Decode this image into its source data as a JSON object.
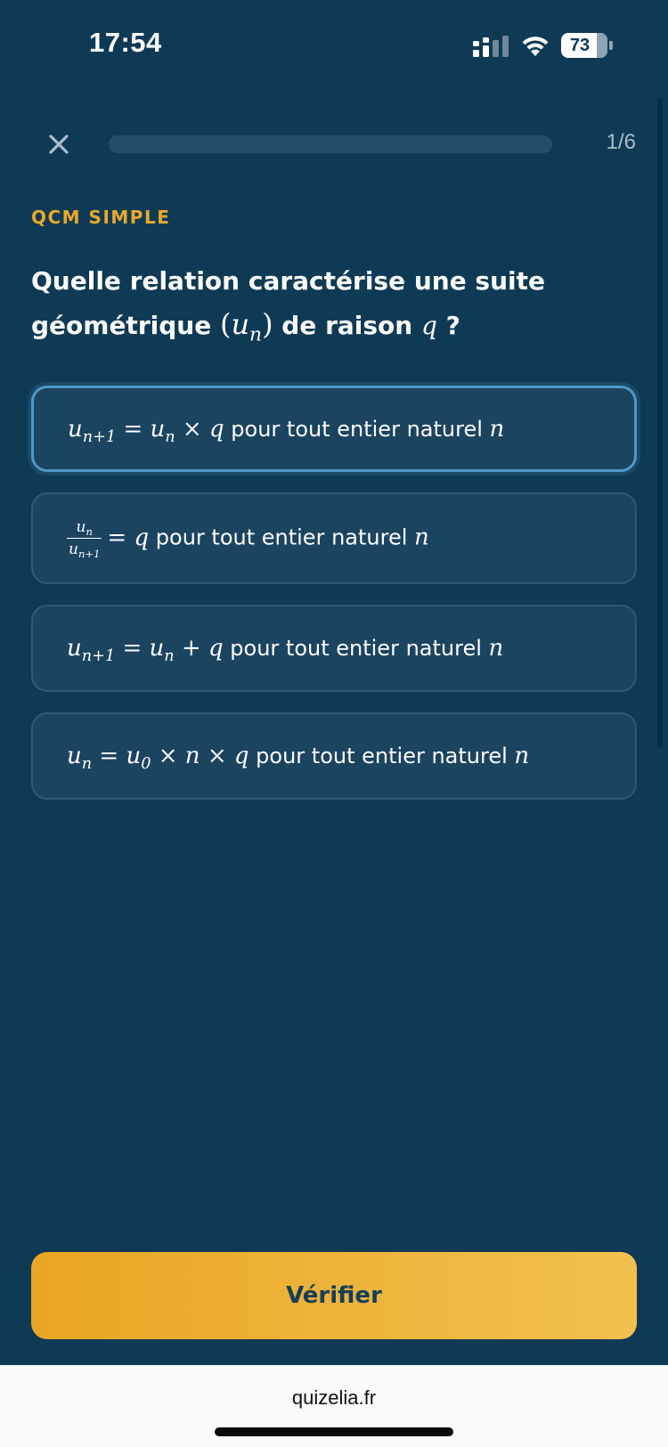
{
  "status_bar": {
    "time": "17:54",
    "battery": "73",
    "icons": [
      "signal-icon",
      "wifi-icon",
      "battery-icon"
    ]
  },
  "header": {
    "close_icon": "close-icon",
    "progress_text": "1/6",
    "progress_fraction": 0
  },
  "question": {
    "type_label": "QCM SIMPLE",
    "line1": "Quelle relation caractérise une suite",
    "line2_start": "géométrique",
    "sequence": "(un)",
    "line2_mid": "de raison",
    "ratio_var": "q",
    "line2_end": "?"
  },
  "options": [
    {
      "formula": "un+1 = un × q",
      "text": "pour tout entier naturel",
      "var": "n",
      "selected": true
    },
    {
      "formula": "un / un+1 = q",
      "text": "pour tout entier naturel",
      "var": "n",
      "selected": false
    },
    {
      "formula": "un+1 = un + q",
      "text": "pour tout entier naturel",
      "var": "n",
      "selected": false
    },
    {
      "formula": "un = u0 × n × q",
      "text": "pour tout entier naturel",
      "var": "n",
      "selected": false
    }
  ],
  "actions": {
    "verify_label": "Vérifier"
  },
  "browser": {
    "url": "quizelia.fr"
  },
  "colors": {
    "background": "#0f3a55",
    "accent": "#e8a92b",
    "option_bg": "#1b4461",
    "selected_border": "#4f97c8",
    "button_text": "#143f5b"
  }
}
